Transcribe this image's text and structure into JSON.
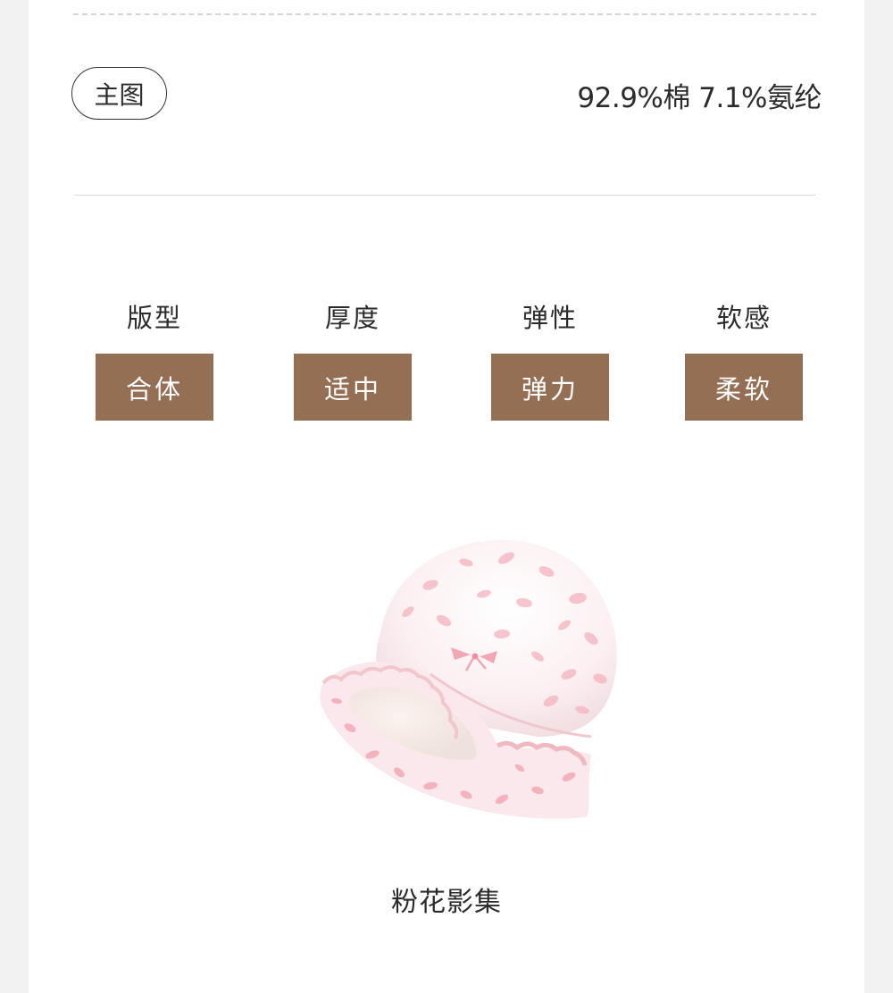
{
  "header": {
    "tag_label": "主图",
    "material": "92.9%棉 7.1%氨纶"
  },
  "attributes": [
    {
      "label": "版型",
      "value": "合体"
    },
    {
      "label": "厚度",
      "value": "适中"
    },
    {
      "label": "弹性",
      "value": "弹力"
    },
    {
      "label": "软感",
      "value": "柔软"
    }
  ],
  "product": {
    "name": "粉花影集"
  },
  "colors": {
    "accent": "#956f54",
    "text": "#2b2b2b",
    "background": "#f2f2f2",
    "card": "#ffffff",
    "hat_pink": "#f3a9b6"
  }
}
